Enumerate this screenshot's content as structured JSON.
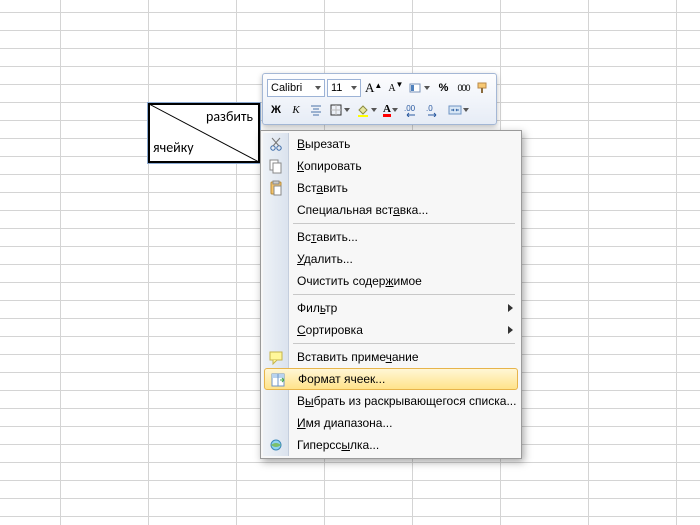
{
  "cell": {
    "text_top_right": "разбить",
    "text_bottom_left": "ячейку"
  },
  "minibar": {
    "font_name": "Calibri",
    "font_size": "11",
    "grow_label": "A",
    "shrink_label": "A",
    "percent": "%",
    "thousands": "000",
    "bold": "Ж",
    "italic": "К"
  },
  "menu": {
    "cut": "Вырезать",
    "copy": "Копировать",
    "paste": "Вставить",
    "paste_special": "Специальная вставка...",
    "insert": "Вставить...",
    "delete": "Удалить...",
    "clear": "Очистить содержимое",
    "filter": "Фильтр",
    "sort": "Сортировка",
    "comment": "Вставить примечание",
    "format_cells": "Формат ячеек...",
    "pick_list": "Выбрать из раскрывающегося списка...",
    "range_name": "Имя диапазона...",
    "hyperlink": "Гиперссылка..."
  }
}
